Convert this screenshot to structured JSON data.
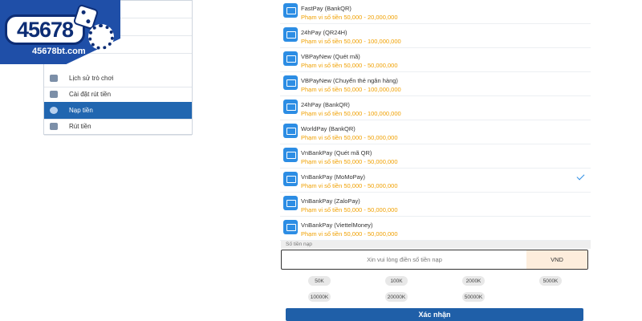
{
  "logo": {
    "digits": "45678",
    "url": "45678bt.com"
  },
  "menu": {
    "items": [
      {
        "label": "",
        "icon": "blank"
      },
      {
        "label": "",
        "icon": "blank"
      },
      {
        "label": "",
        "icon": "blank"
      },
      {
        "label": "Lịch sử trò chơi",
        "icon": "history-icon"
      },
      {
        "label": "Cài đặt rút tiền",
        "icon": "settings-icon"
      },
      {
        "label": "Nạp tiền",
        "icon": "piggy-bank-icon",
        "active": true
      },
      {
        "label": "Rút tiền",
        "icon": "card-icon"
      }
    ]
  },
  "payments": [
    {
      "name": "FastPay (BankQR)",
      "range": "Phạm vi số tiền 50,000 - 20,000,000"
    },
    {
      "name": "24hPay (QR24H)",
      "range": "Phạm vi số tiền 50,000 - 100,000,000"
    },
    {
      "name": "VBPayNew (Quét mã)",
      "range": "Phạm vi số tiền 50,000 - 50,000,000"
    },
    {
      "name": "VBPayNew (Chuyển thẻ ngân hàng)",
      "range": "Phạm vi số tiền 50,000 - 100,000,000"
    },
    {
      "name": "24hPay (BankQR)",
      "range": "Phạm vi số tiền 50,000 - 100,000,000"
    },
    {
      "name": "WorldPay (BankQR)",
      "range": "Phạm vi số tiền 50,000 - 50,000,000"
    },
    {
      "name": "VnBankPay (Quét mã QR)",
      "range": "Phạm vi số tiền 50,000 - 50,000,000"
    },
    {
      "name": "VnBankPay (MoMoPay)",
      "range": "Phạm vi số tiền 50,000 - 50,000,000",
      "selected": true
    },
    {
      "name": "VnBankPay (ZaloPay)",
      "range": "Phạm vi số tiền 50,000 - 50,000,000"
    },
    {
      "name": "VnBankPay (ViettelMoney)",
      "range": "Phạm vi số tiền 50,000 - 50,000,000"
    }
  ],
  "amount": {
    "label": "Số tiền nạp",
    "placeholder": "Xin vui lòng điền số tiền nạp",
    "unit": "VND",
    "presets": [
      "50K",
      "100K",
      "2000K",
      "5000K",
      "10000K",
      "20000K",
      "50000K"
    ]
  },
  "confirm_label": "Xác nhận",
  "colors": {
    "brand": "#1f5fa8",
    "menu_active": "#2166b0",
    "range_text": "#f0a000",
    "icon_blue": "#2c8de4"
  }
}
